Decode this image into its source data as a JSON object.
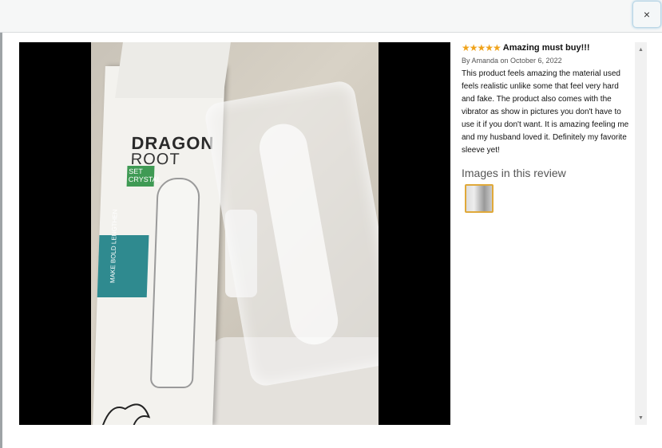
{
  "header": {
    "close_label": "×"
  },
  "photo": {
    "brand_title": "DRAGON",
    "brand_sub": "ROOT",
    "badge_line1": "SET",
    "badge_line2": "CRYSTAL",
    "teal_text": "MAKE BOLD LENGTHEN"
  },
  "review": {
    "stars": "★★★★★",
    "title": "Amazing must buy!!!",
    "byline": "By Amanda on October 6, 2022",
    "body": "This product feels amazing the material used feels realistic unlike some that feel very hard and fake. The product also comes with the vibrator as show in pictures you don't have to use it if you don't want. It is amazing feeling me and my husband loved it. Definitely my favorite sleeve yet!",
    "images_heading": "Images in this review",
    "rating": 5
  },
  "scrollbar": {
    "up_icon": "▲",
    "down_icon": "▼"
  },
  "colors": {
    "star": "#f0a31b",
    "thumb_border": "#e0a93a",
    "badge_green": "#3f9a54",
    "teal": "#2f8a8f"
  }
}
